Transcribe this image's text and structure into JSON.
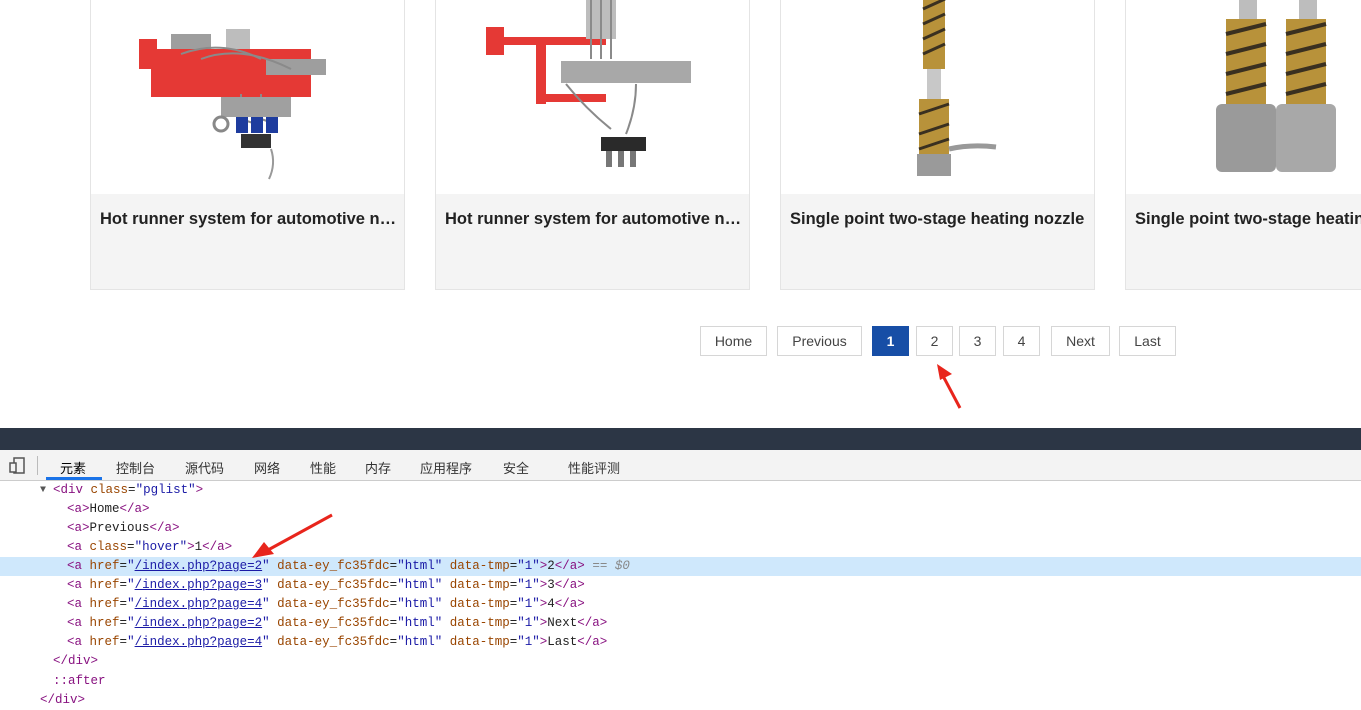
{
  "products": [
    {
      "title": "Hot runner system for automotive ne..."
    },
    {
      "title": "Hot runner system for automotive ne..."
    },
    {
      "title": "Single point two-stage heating nozzle"
    },
    {
      "title": "Single point two-stage heating"
    }
  ],
  "pagination": {
    "home": "Home",
    "previous": "Previous",
    "pages": [
      "1",
      "2",
      "3",
      "4"
    ],
    "current": "1",
    "next": "Next",
    "last": "Last",
    "active_color": "#174ea6"
  },
  "devtools": {
    "tabs": [
      "元素",
      "控制台",
      "源代码",
      "网络",
      "性能",
      "内存",
      "应用程序",
      "安全",
      "性能评测"
    ],
    "active_tab": "元素",
    "dom": {
      "div_open_tag": "<div",
      "div_class_attr": "class",
      "div_class_value": "\"pglist\"",
      "div_close_bracket": ">",
      "a_open": "<a",
      "a_close_bracket": ">",
      "a_end": "</a>",
      "home_text": "Home",
      "previous_text": "Previous",
      "hover_attr": "class",
      "hover_value": "\"hover\"",
      "hover_text": "1",
      "href_attr": "href",
      "data_ey_attr": "data-ey_fc35fdc",
      "data_ey_value": "\"html\"",
      "data_tmp_attr": "data-tmp",
      "data_tmp_value": "\"1\"",
      "eq_sign": "=",
      "quote": "\"",
      "links": [
        {
          "href": "/index.php?page=2",
          "text": "2"
        },
        {
          "href": "/index.php?page=3",
          "text": "3"
        },
        {
          "href": "/index.php?page=4",
          "text": "4"
        },
        {
          "href": "/index.php?page=2",
          "text": "Next"
        },
        {
          "href": "/index.php?page=4",
          "text": "Last"
        }
      ],
      "selected_marker": "== $0",
      "div_end": "</div>",
      "after_pseudo": "::after",
      "outer_end": "</div>"
    }
  },
  "colors": {
    "accent": "#1a73e8",
    "selected_row": "#cfe8fc",
    "devtools_bar": "#2c3645",
    "annotation_arrow": "#e8251c"
  }
}
